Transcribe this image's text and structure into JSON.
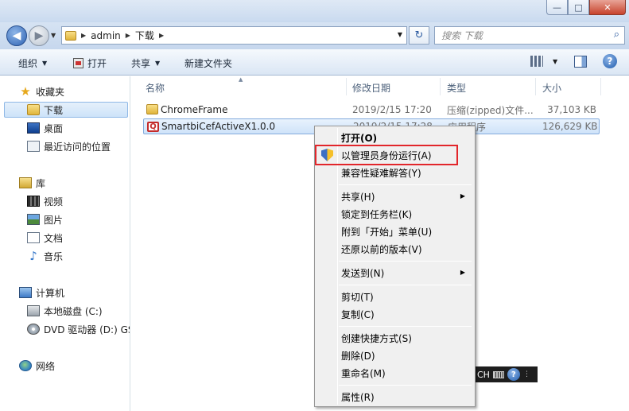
{
  "window": {
    "controls": {
      "minimize": "—",
      "maximize": "□",
      "close": "✕"
    }
  },
  "address": {
    "crumbs": [
      "admin",
      "下载"
    ],
    "search_placeholder": "搜索 下载"
  },
  "toolbar": {
    "organize": "组织",
    "open": "打开",
    "share": "共享",
    "new_folder": "新建文件夹"
  },
  "sidebar": {
    "favorites": "收藏夹",
    "downloads": "下载",
    "desktop": "桌面",
    "recent": "最近访问的位置",
    "libraries": "库",
    "videos": "视频",
    "pictures": "图片",
    "documents": "文档",
    "music": "音乐",
    "computer": "计算机",
    "local_disk": "本地磁盘 (C:)",
    "dvd": "DVD 驱动器 (D:) GS",
    "network": "网络"
  },
  "columns": {
    "name": "名称",
    "date": "修改日期",
    "type": "类型",
    "size": "大小"
  },
  "files": [
    {
      "name": "ChromeFrame",
      "date": "2019/2/15 17:20",
      "type": "压缩(zipped)文件...",
      "size": "37,103 KB",
      "icon": "zip-folder-icon"
    },
    {
      "name": "SmartbiCefActiveX1.0.0",
      "date": "2019/2/15 17:28",
      "type": "应用程序",
      "size": "126,629 KB",
      "icon": "app-icon"
    }
  ],
  "context_menu": {
    "open": "打开(O)",
    "run_as_admin": "以管理员身份运行(A)",
    "troubleshoot": "兼容性疑难解答(Y)",
    "share": "共享(H)",
    "pin_taskbar": "锁定到任务栏(K)",
    "pin_start": "附到「开始」菜单(U)",
    "restore": "还原以前的版本(V)",
    "send_to": "发送到(N)",
    "cut": "剪切(T)",
    "copy": "复制(C)",
    "shortcut": "创建快捷方式(S)",
    "delete": "删除(D)",
    "rename": "重命名(M)",
    "properties": "属性(R)"
  },
  "langbar": {
    "text": "CH"
  },
  "colors": {
    "highlight": "#e2262b",
    "selection": "#cfe3f9"
  }
}
